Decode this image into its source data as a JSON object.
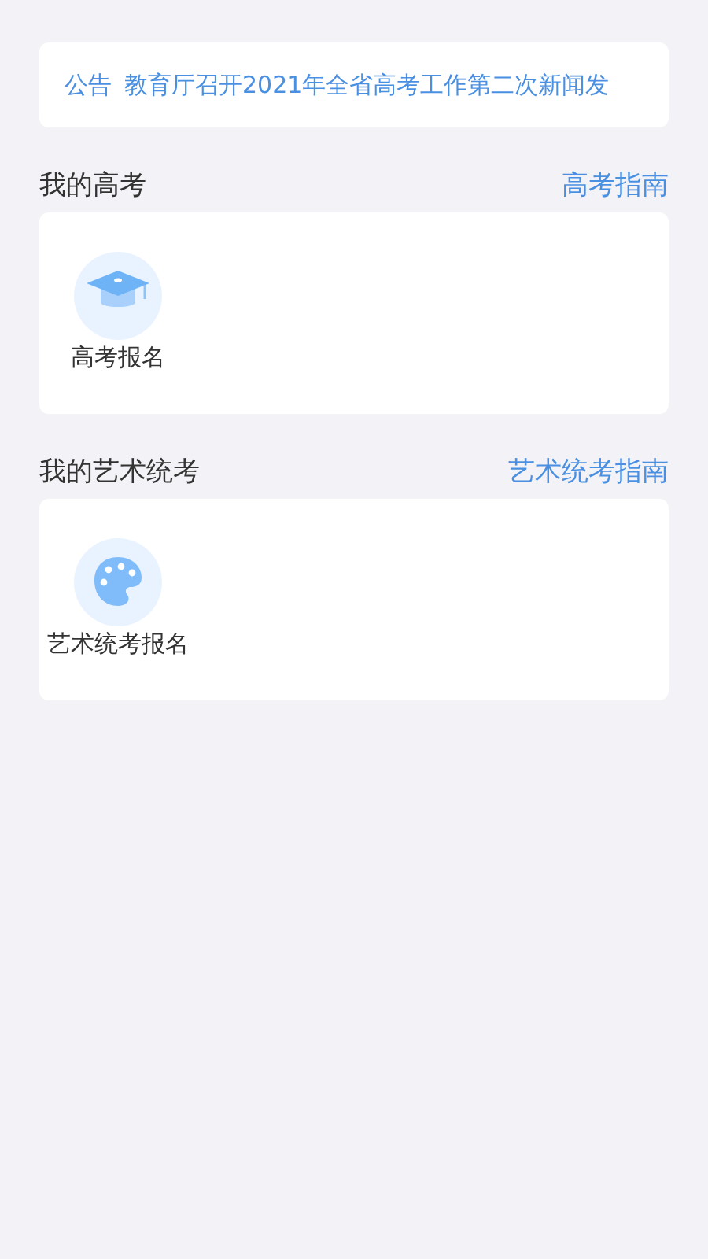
{
  "notice": {
    "label": "公告",
    "text": "教育厅召开2021年全省高考工作第二次新闻发"
  },
  "sections": [
    {
      "title": "我的高考",
      "link": "高考指南",
      "items": [
        {
          "kind": "cap",
          "label": "高考报名"
        }
      ]
    },
    {
      "title": "我的艺术统考",
      "link": "艺术统考指南",
      "items": [
        {
          "kind": "palette",
          "label": "艺术统考报名"
        }
      ]
    }
  ]
}
